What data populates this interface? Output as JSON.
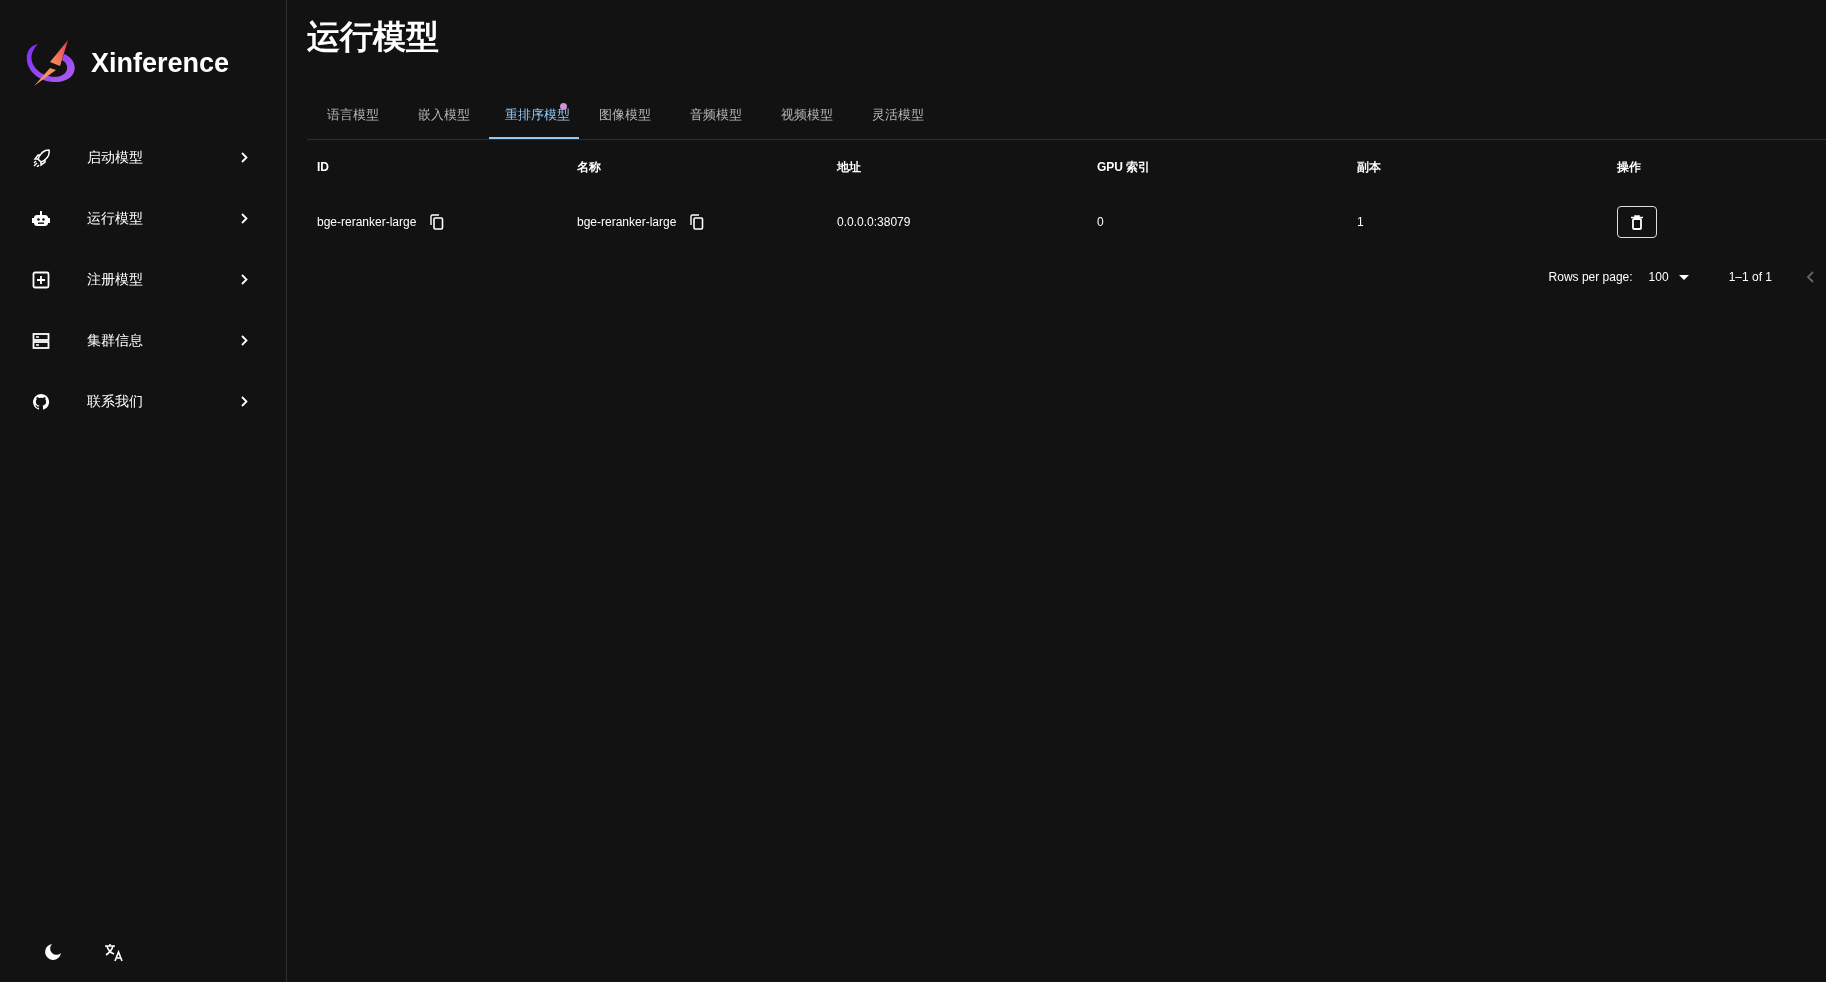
{
  "brand": {
    "name": "Xinference"
  },
  "sidebar": {
    "items": [
      {
        "label": "启动模型",
        "kind": "rocket"
      },
      {
        "label": "运行模型",
        "kind": "robot"
      },
      {
        "label": "注册模型",
        "kind": "add"
      },
      {
        "label": "集群信息",
        "kind": "server"
      },
      {
        "label": "联系我们",
        "kind": "github"
      }
    ]
  },
  "page": {
    "title": "运行模型"
  },
  "tabs": [
    {
      "label": "语言模型",
      "selected": false,
      "dot": false
    },
    {
      "label": "嵌入模型",
      "selected": false,
      "dot": false
    },
    {
      "label": "重排序模型",
      "selected": true,
      "dot": true
    },
    {
      "label": "图像模型",
      "selected": false,
      "dot": false
    },
    {
      "label": "音频模型",
      "selected": false,
      "dot": false
    },
    {
      "label": "视频模型",
      "selected": false,
      "dot": false
    },
    {
      "label": "灵活模型",
      "selected": false,
      "dot": false
    }
  ],
  "table": {
    "columns": [
      "ID",
      "名称",
      "地址",
      "GPU 索引",
      "副本",
      "操作"
    ],
    "rows": [
      {
        "id": "bge-reranker-large",
        "name": "bge-reranker-large",
        "address": "0.0.0.0:38079",
        "gpu_index": "0",
        "replicas": "1"
      }
    ]
  },
  "pagination": {
    "rows_per_page_label": "Rows per page:",
    "rows_per_page": "100",
    "range": "1–1 of 1"
  }
}
